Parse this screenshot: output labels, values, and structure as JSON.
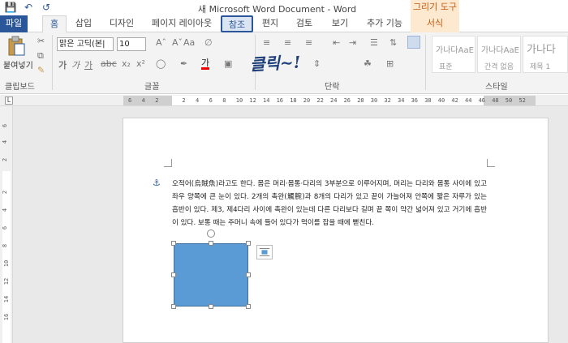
{
  "title": "새 Microsoft Word Document - Word",
  "context_tab_group": "그리기 도구",
  "tabs": [
    "파일",
    "홈",
    "삽입",
    "디자인",
    "페이지 레이아웃",
    "참조",
    "편지",
    "검토",
    "보기",
    "추가 기능",
    "서식"
  ],
  "ribbon": {
    "paste_label": "붙여넣기",
    "font_name": "맑은 고딕(본|",
    "font_size": "10",
    "groups": {
      "clipboard": "클립보드",
      "font": "글꼴",
      "paragraph": "단락",
      "styles": "스타일"
    },
    "styles": [
      {
        "sample": "가나다AaE",
        "name": "표준"
      },
      {
        "sample": "가나다AaE",
        "name": "간격 없음"
      },
      {
        "sample": "가나다",
        "name": "제목 1"
      }
    ]
  },
  "annotation": "클릭~!",
  "ruler_ticks": [
    "6",
    "4",
    "2",
    "",
    "2",
    "4",
    "6",
    "8",
    "10",
    "12",
    "14",
    "16",
    "18",
    "20",
    "22",
    "24",
    "26",
    "28",
    "30",
    "32",
    "34",
    "36",
    "38",
    "40",
    "42",
    "44",
    "46",
    "48",
    "50",
    "52"
  ],
  "vruler_ticks": [
    "6",
    "4",
    "2",
    "2",
    "4",
    "6",
    "8",
    "10",
    "12",
    "14",
    "16"
  ],
  "document": {
    "text": "오적어(烏賊魚)라고도 한다. 몸은 머리·몸통·다리의 3부분으로 이루어지며, 머리는 다리와 몸통 사이에 있고 좌우 양쪽에 큰 눈이 있다. 2개의 촉완(觸腕)과 8개의 다리가 있고 끝이 가늘어져 안쪽에 짧은 자루가 있는 흡반이 있다. 제3, 제4다리 사이에 촉완이 있는데 다른 다리보다 길며 끝 쪽이 약간 넓어져 있고 거기에 흡반이 있다. 보통 때는 주머니 속에 들어 있다가 먹이를 잡을 때에 뻗친다."
  },
  "colors": {
    "word_blue": "#2b579a",
    "shape_fill": "#5b9bd5",
    "context_orange": "#fde9cf"
  }
}
